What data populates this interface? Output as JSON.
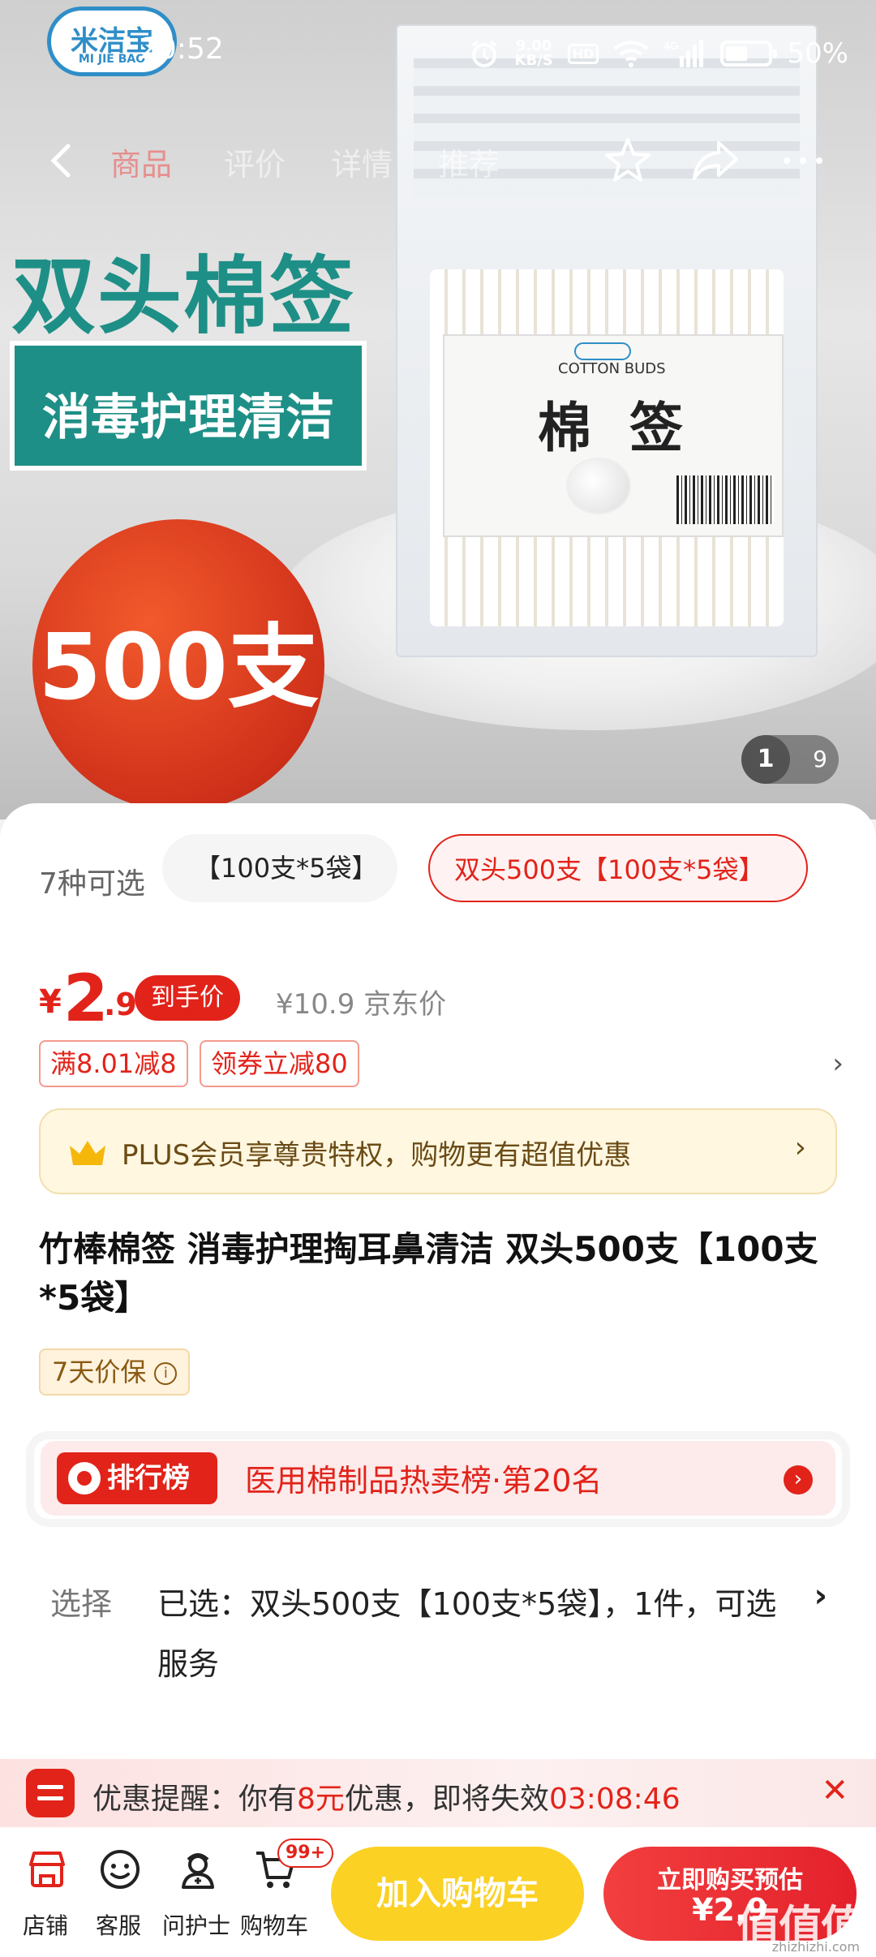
{
  "status_bar": {
    "time": "20:52",
    "net_speed_value": "9.00",
    "net_speed_unit": "KB/S",
    "hd": "HD",
    "network": "4G",
    "battery": "50%"
  },
  "hero": {
    "logo_text": "米洁宝",
    "logo_sub": "MI JIE BAO",
    "nav_tabs": [
      "商品",
      "评价",
      "详情",
      "推荐"
    ],
    "title": "双头棉签",
    "band_text": "消毒护理清洁",
    "circle_text": "500支",
    "package_en": "COTTON BUDS",
    "package_cn": "棉 签",
    "image_index": "1",
    "image_total": "9"
  },
  "variants": {
    "count_label": "7种可选",
    "chips": [
      "【100支*5袋】",
      "双头500支【100支*5袋】"
    ]
  },
  "price": {
    "yen": "¥",
    "integer": "2",
    "decimal": ".9",
    "tag": "到手价",
    "original": "¥10.9 京东价"
  },
  "coupons": [
    "满8.01减8",
    "领券立减80"
  ],
  "plus": {
    "text": "PLUS会员享尊贵特权，购物更有超值优惠",
    "arrow": "›"
  },
  "product_title": "竹棒棉签 消毒护理掏耳鼻清洁 双头500支【100支*5袋】",
  "guarantee": "7天价保",
  "ranking": {
    "badge": "排行榜",
    "text": "医用棉制品热卖榜·第20名"
  },
  "selection": {
    "label": "选择",
    "value": "已选：双头500支【100支*5袋】，1件，可选服务",
    "arrow": "›"
  },
  "promo": {
    "prefix": "优惠提醒：你有",
    "amount": "8元",
    "middle": "优惠，即将失效",
    "countdown": "03:08:46",
    "close": "✕"
  },
  "bottom_bar": {
    "tabs": [
      "店铺",
      "客服",
      "问护士",
      "购物车"
    ],
    "cart_badge": "99+",
    "add_to_cart": "加入购物车",
    "buy_line1": "立即购买预估",
    "buy_line2": "¥2.9"
  },
  "watermark": "值值值",
  "watermark_sub": "zhizhizhi.com",
  "colors": {
    "accent_red": "#e2231a",
    "cart_yellow": "#fbd123",
    "brand_teal": "#1e8f86"
  }
}
